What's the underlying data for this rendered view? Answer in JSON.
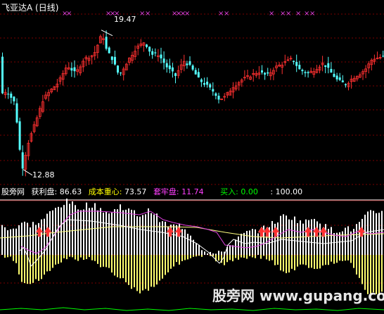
{
  "upper_panel": {
    "title": "飞亚达A (日线)",
    "markers": {
      "label": "×××",
      "color": "#e040e0"
    },
    "annotations": {
      "high": "19.47",
      "low": "12.88"
    },
    "chart_data": {
      "type": "candlestick",
      "title": "飞亚达A (日线)",
      "price_range": [
        12.2,
        20.2
      ],
      "gridlines": true,
      "up_color": "#ff3030",
      "down_color": "#54ffff",
      "high_label": 19.47,
      "low_label": 12.88
    }
  },
  "lower_panel": {
    "label_source": "股旁网",
    "indicators": [
      {
        "label": "获利盘:",
        "value": "86.63",
        "color": "#ffffff"
      },
      {
        "label": "成本重心:",
        "value": "73.57",
        "color": "#ffff00"
      },
      {
        "label": "套牢盘:",
        "value": "11.74",
        "color": "#ff40ff"
      },
      {
        "label": "买入:",
        "value": "0.00",
        "color": "#00ff00"
      },
      {
        "label": ":",
        "value": "100.00",
        "color": "#ffffff"
      }
    ],
    "chart_data": {
      "type": "bar",
      "range": [
        -100,
        100
      ],
      "series": [
        {
          "name": "获利盘",
          "color": "#ffffff"
        },
        {
          "name": "套牢盘",
          "color": "#ffff70"
        },
        {
          "name": "成本重心",
          "color": "#ffff80"
        },
        {
          "name": "买入",
          "color": "#00ff00"
        }
      ]
    }
  },
  "watermark": "股旁网 www.gupang.com"
}
